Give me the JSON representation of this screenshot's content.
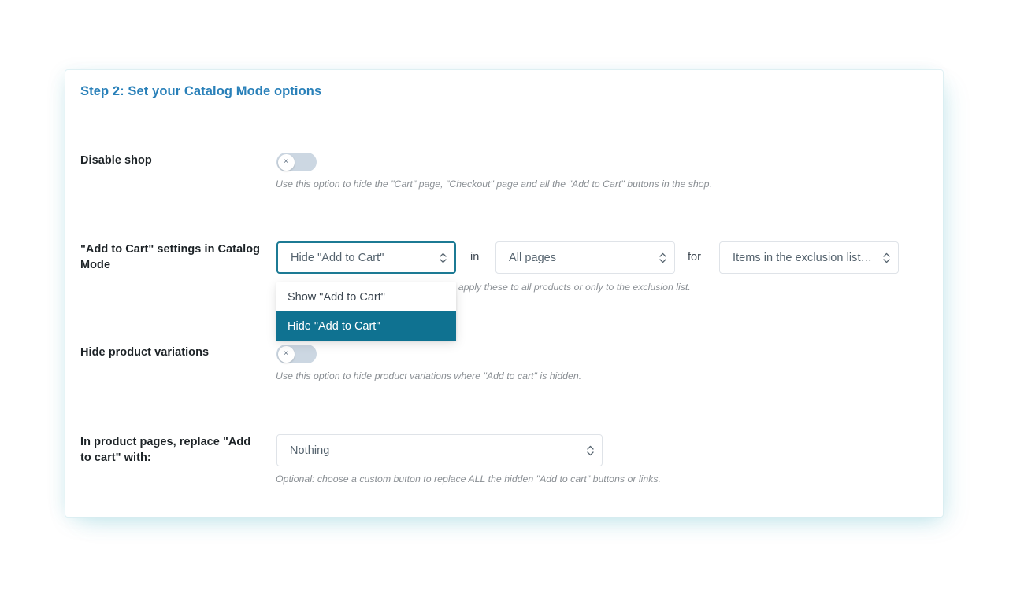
{
  "card": {
    "title": "Step 2: Set your Catalog Mode options"
  },
  "rows": {
    "disable_shop": {
      "label": "Disable shop",
      "toggle_state": "off",
      "toggle_glyph": "×",
      "help": "Use this option to hide the \"Cart\" page, \"Checkout\" page and all the \"Add to Cart\" buttons in the shop."
    },
    "add_to_cart_settings": {
      "label": "\"Add to Cart\" settings in Catalog Mode",
      "select_action_value": "Hide \"Add to Cart\"",
      "conjunction_in": "in",
      "select_scope_value": "All pages",
      "conjunction_for": "for",
      "select_target_value": "Items in the exclusion list o...",
      "help": "to apply these to all products or only to the exclusion list.",
      "dropdown_options": [
        "Show \"Add to Cart\"",
        "Hide \"Add to Cart\""
      ],
      "dropdown_selected_index": 1
    },
    "hide_variations": {
      "label": "Hide product variations",
      "toggle_state": "off",
      "toggle_glyph": "×",
      "help": "Use this option to hide product variations where \"Add to cart\" is hidden."
    },
    "replace_add_to_cart": {
      "label": "In product pages, replace \"Add to cart\" with:",
      "select_value": "Nothing",
      "help": "Optional: choose a custom button to replace ALL the hidden \"Add to cart\" buttons or links."
    }
  },
  "colors": {
    "title_blue": "#2980b9",
    "focus_teal": "#1c7a94",
    "dropdown_highlight": "#0f7291",
    "toggle_track_off": "#ccd7e2",
    "label_dark": "#1d2327",
    "help_gray": "#8a8f94"
  }
}
